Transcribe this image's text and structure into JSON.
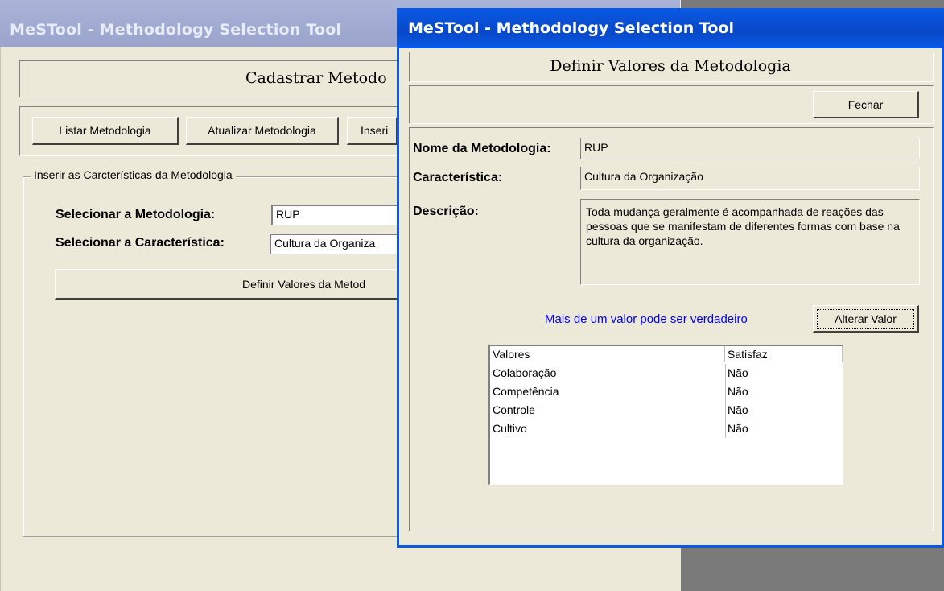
{
  "back_window": {
    "title": "MeSTool - Methodology Selection Tool",
    "heading": "Cadastrar Metodo",
    "toolbar": {
      "list_label": "Listar Metodologia",
      "update_label": "Atualizar Metodologia",
      "insert_label": "Inseri"
    },
    "group_label": "Inserir as Carcterísticas da Metodologia",
    "select_methodology_label": "Selecionar a Metodologia:",
    "select_methodology_value": "RUP",
    "select_characteristic_label": "Selecionar a Característica:",
    "select_characteristic_value": "Cultura da Organiza",
    "define_button_label": "Definir Valores da Metod"
  },
  "dialog": {
    "title": "MeSTool - Methodology Selection Tool",
    "heading": "Definir Valores da Metodologia",
    "close_label": "Fechar",
    "name_label": "Nome da Metodologia:",
    "name_value": "RUP",
    "characteristic_label": "Característica:",
    "characteristic_value": "Cultura da Organização",
    "description_label": "Descrição:",
    "description_value": "Toda mudança geralmente é acompanhada de reações das pessoas que se manifestam de diferentes formas com base na cultura da organização.",
    "hint": "Mais de um valor pode ser verdadeiro",
    "change_value_label": "Alterar Valor",
    "table": {
      "columns": [
        "Valores",
        "Satisfaz"
      ],
      "rows": [
        [
          "Colaboração",
          "Não"
        ],
        [
          "Competência",
          "Não"
        ],
        [
          "Controle",
          "Não"
        ],
        [
          "Cultivo",
          "Não"
        ]
      ]
    }
  },
  "colors": {
    "hint_text": "#0000ff",
    "active_title": "#0a5ae6",
    "inactive_title": "#9aa4cc"
  }
}
